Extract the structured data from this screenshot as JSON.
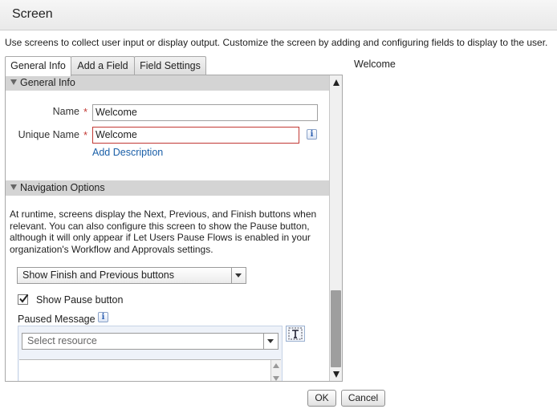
{
  "header": {
    "title": "Screen"
  },
  "intro": "Use screens to collect user input or display output. Customize the screen by adding and configuring fields to display to the user.",
  "tabs": [
    {
      "label": "General Info",
      "active": true
    },
    {
      "label": "Add a Field",
      "active": false
    },
    {
      "label": "Field Settings",
      "active": false
    }
  ],
  "general_info": {
    "section_title": "General Info",
    "name_label": "Name",
    "name_value": "Welcome",
    "unique_name_label": "Unique Name",
    "unique_name_value": "Welcome",
    "required_mark": "*",
    "info_glyph": "i",
    "add_description": "Add Description"
  },
  "navigation": {
    "section_title": "Navigation Options",
    "description": "At runtime, screens display the Next, Previous, and Finish buttons when relevant. You can also configure this screen to show the Pause button, although it will only appear if Let Users Pause Flows is enabled in your organization's Workflow and Approvals settings.",
    "buttons_select_value": "Show Finish and Previous buttons",
    "show_pause_label": "Show Pause button",
    "show_pause_checked": true,
    "paused_message_label": "Paused Message",
    "resource_placeholder": "Select resource"
  },
  "preview": {
    "title": "Welcome"
  },
  "footer": {
    "ok_label": "OK",
    "cancel_label": "Cancel"
  },
  "colors": {
    "required": "#c23934",
    "link": "#1a5fa8",
    "section_bar": "#d4d4d4"
  }
}
